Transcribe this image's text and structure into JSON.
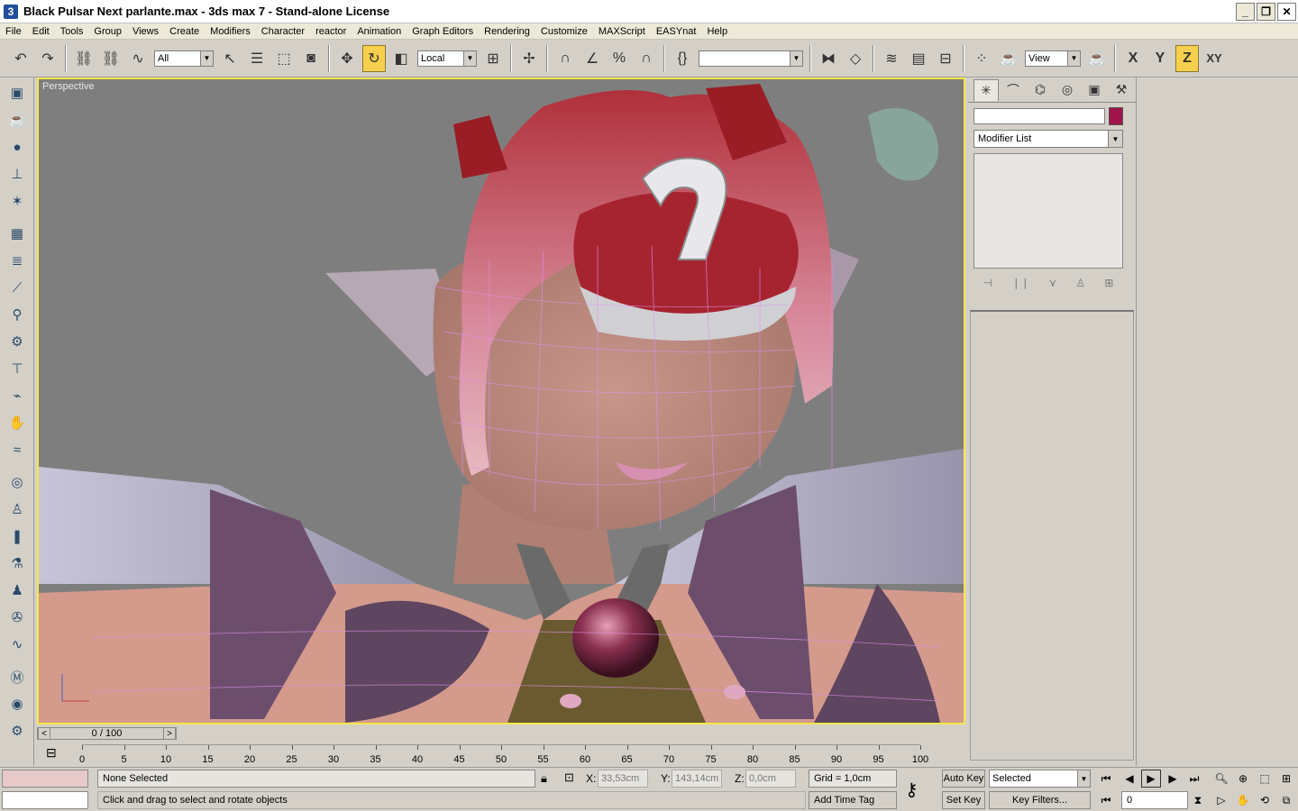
{
  "window": {
    "title": "Black Pulsar Next parlante.max - 3ds max 7  - Stand-alone License",
    "app_icon": "3"
  },
  "menu": [
    "File",
    "Edit",
    "Tools",
    "Group",
    "Views",
    "Create",
    "Modifiers",
    "Character",
    "reactor",
    "Animation",
    "Graph Editors",
    "Rendering",
    "Customize",
    "MAXScript",
    "EASYnat",
    "Help"
  ],
  "toolbar": {
    "selection_filter": "All",
    "ref_coord": "Local",
    "named_selection": "",
    "render_view": "View",
    "axis": {
      "x": "X",
      "y": "Y",
      "z": "Z",
      "xy": "XY"
    }
  },
  "viewport": {
    "label": "Perspective"
  },
  "command_panel": {
    "modifier_list": "Modifier List",
    "swatch_color": "#a0144a"
  },
  "time_slider": {
    "label": "0 / 100",
    "ticks": [
      "0",
      "5",
      "10",
      "15",
      "20",
      "25",
      "30",
      "35",
      "40",
      "45",
      "50",
      "55",
      "60",
      "65",
      "70",
      "75",
      "80",
      "85",
      "90",
      "95",
      "100"
    ]
  },
  "status": {
    "selection": "None Selected",
    "prompt": "Click and drag to select and rotate objects",
    "x_label": "X:",
    "x_value": "33,53cm",
    "y_label": "Y:",
    "y_value": "143,14cm",
    "z_label": "Z:",
    "z_value": "0,0cm",
    "grid": "Grid = 1,0cm",
    "add_time_tag": "Add Time Tag",
    "auto_key": "Auto Key",
    "set_key": "Set Key",
    "key_mode": "Selected",
    "key_filters": "Key Filters...",
    "frame": "0"
  }
}
